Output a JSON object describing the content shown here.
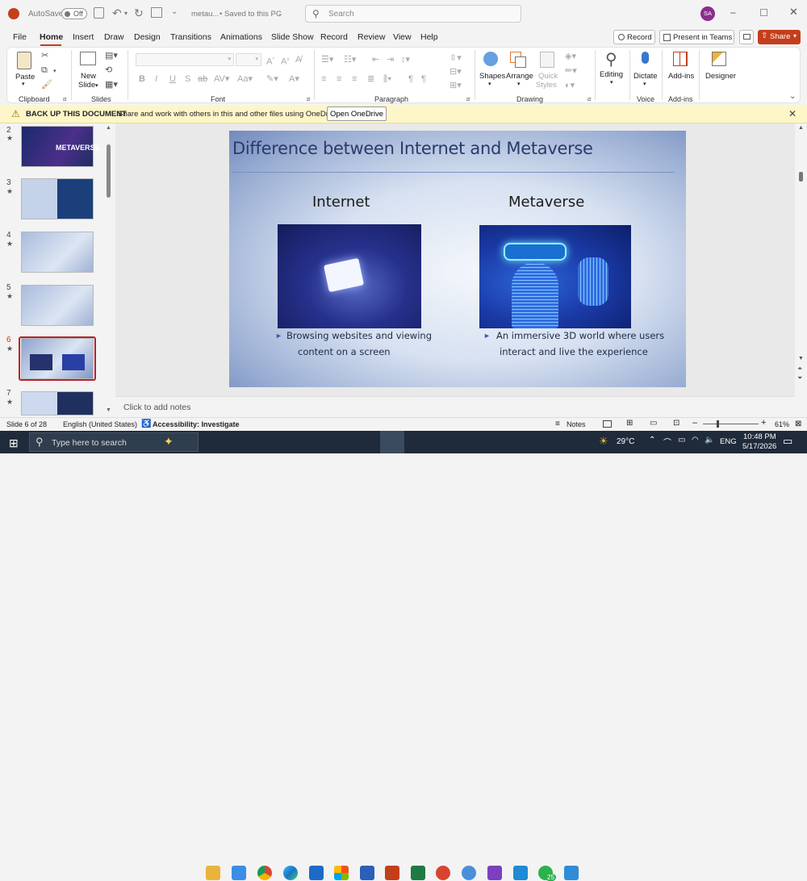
{
  "titlebar": {
    "autosave_label": "AutoSave",
    "autosave_state": "Off",
    "doc_name": "metau...",
    "saved_status": "• Saved to this PC",
    "search_placeholder": "Search",
    "user_initials": "SA"
  },
  "tabs": [
    "File",
    "Home",
    "Insert",
    "Draw",
    "Design",
    "Transitions",
    "Animations",
    "Slide Show",
    "Record",
    "Review",
    "View",
    "Help"
  ],
  "tab_actions": {
    "record": "Record",
    "present_teams": "Present in Teams",
    "share": "Share"
  },
  "ribbon": {
    "clipboard": {
      "paste": "Paste",
      "label": "Clipboard"
    },
    "slides": {
      "new_slide_1": "New",
      "new_slide_2": "Slide",
      "label": "Slides"
    },
    "font": {
      "label": "Font"
    },
    "paragraph": {
      "label": "Paragraph"
    },
    "drawing": {
      "shapes": "Shapes",
      "arrange": "Arrange",
      "quick_styles_1": "Quick",
      "quick_styles_2": "Styles",
      "label": "Drawing"
    },
    "editing": {
      "label": "Editing"
    },
    "voice": {
      "dictate": "Dictate",
      "label": "Voice"
    },
    "addins": {
      "btn": "Add-ins",
      "label": "Add-ins"
    },
    "designer": {
      "btn": "Designer"
    }
  },
  "notice": {
    "title": "BACK UP THIS DOCUMENT",
    "message": "Share and work with others in this and other files using OneDrive.",
    "button": "Open OneDrive"
  },
  "thumbnails": [
    {
      "num": "2",
      "title": "METAVERSE"
    },
    {
      "num": "3",
      "title": ""
    },
    {
      "num": "4",
      "title": ""
    },
    {
      "num": "5",
      "title": ""
    },
    {
      "num": "6",
      "title": ""
    },
    {
      "num": "7",
      "title": ""
    }
  ],
  "slide": {
    "title": "Difference between Internet and Metaverse",
    "left_heading": "Internet",
    "right_heading": "Metaverse",
    "left_bullet_1": "Browsing websites and viewing",
    "left_bullet_2": "content on a screen",
    "right_bullet_1": "An immersive 3D world where users",
    "right_bullet_2": "interact and live the experience"
  },
  "notes_placeholder": "Click to add notes",
  "status": {
    "slide_count": "Slide 6 of 28",
    "language": "English (United States)",
    "accessibility": "Accessibility: Investigate",
    "notes": "Notes",
    "zoom": "61%"
  },
  "taskbar": {
    "search_placeholder": "Type here to search",
    "weather": "29°C",
    "lang": "ENG",
    "time": "10:48 PM",
    "date": "5/17/2026",
    "whatsapp_badge": "25"
  },
  "colors": {
    "accent": "#c43e1c",
    "ribbon_bg": "#ffffff",
    "taskbar": "#1f2b3a"
  }
}
